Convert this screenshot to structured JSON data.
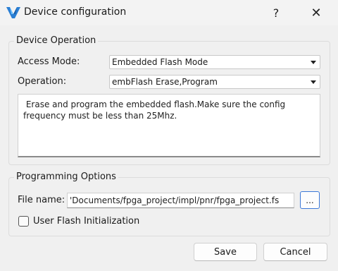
{
  "window": {
    "title": "Device configuration",
    "help_label": "?",
    "close_label": "✕",
    "app_icon": "gowin-logo-icon"
  },
  "device_operation": {
    "group_title": "Device Operation",
    "access_mode_label": "Access Mode:",
    "access_mode_value": "Embedded Flash Mode",
    "operation_label": "Operation:",
    "operation_value": "embFlash Erase,Program",
    "description": " Erase and program the embedded flash.Make sure the config\nfrequency must be less than 25Mhz."
  },
  "programming_options": {
    "group_title": "Programming Options",
    "file_name_label": "File name:",
    "file_name_value": "'Documents/fpga_project/impl/pnr/fpga_project.fs",
    "browse_label": "...",
    "user_flash_label": "User Flash Initialization",
    "user_flash_checked": false
  },
  "footer": {
    "save_label": "Save",
    "cancel_label": "Cancel"
  }
}
